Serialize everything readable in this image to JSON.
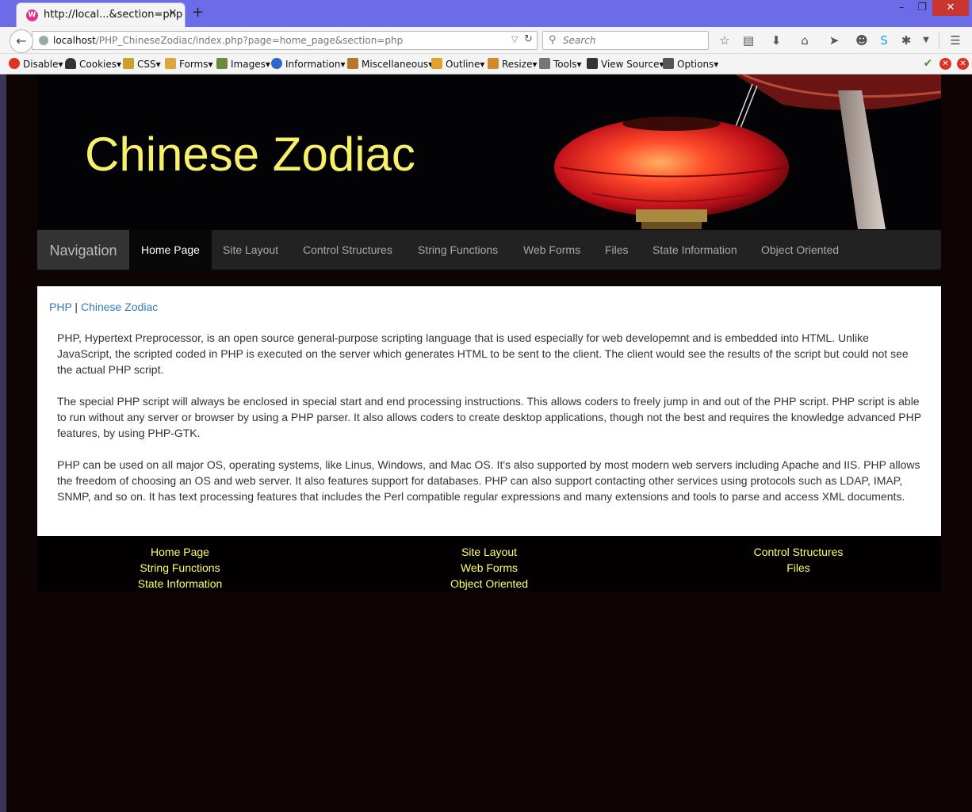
{
  "browser": {
    "tab_title": "http://local...&section=php",
    "tab_close": "✕",
    "new_tab": "+",
    "url_host": "localhost",
    "url_path": "/PHP_ChineseZodiac/index.php?page=home_page&section=php",
    "search_placeholder": "Search",
    "window_minimize": "–",
    "window_maximize": "❐",
    "window_close": "✕"
  },
  "devbar": {
    "items": [
      "Disable▾",
      "Cookies▾",
      "CSS▾",
      "Forms▾",
      "Images▾",
      "Information▾",
      "Miscellaneous▾",
      "Outline▾",
      "Resize▾",
      "Tools▾",
      "View Source▾",
      "Options▾"
    ]
  },
  "site": {
    "banner_title": "Chinese Zodiac",
    "nav_brand": "Navigation",
    "nav_links": [
      "Home Page",
      "Site Layout",
      "Control Structures",
      "String Functions",
      "Web Forms",
      "Files",
      "State Information",
      "Object Oriented"
    ],
    "active_nav": "Home Page",
    "breadcrumb": {
      "first": "PHP",
      "separator": " | ",
      "second": "Chinese Zodiac"
    },
    "paragraphs": [
      "PHP, Hypertext Preprocessor, is an open source general-purpose scripting language that is used especially for web developemnt and is embedded into HTML. Unlike JavaScript, the scripted coded in PHP is executed on the server which generates HTML to be sent to the client. The client would see the results of the script but could not see the actual PHP script.",
      "The special PHP script will always be enclosed in special start and end processing instructions. This allows coders to freely jump in and out of the PHP script. PHP script is able to run without any server or browser by using a PHP parser. It also allows coders to create desktop applications, though not the best and requires the knowledge advanced PHP features, by using PHP-GTK.",
      "PHP can be used on all major OS, operating systems, like Linus, Windows, and Mac OS. It's also supported by most modern web servers including Apache and IIS. PHP allows the freedom of choosing an OS and web server. It also features support for databases. PHP can also support contacting other services using protocols such as LDAP, IMAP, SNMP, and so on. It has text processing features that includes the Perl compatible regular expressions and many extensions and tools to parse and access XML documents."
    ],
    "footer_links": [
      "Home Page",
      "Site Layout",
      "Control Structures",
      "String Functions",
      "Web Forms",
      "Files",
      "State Information",
      "Object Oriented"
    ]
  },
  "colors": {
    "banner_title": "#f7f06b",
    "footer_link": "#ffff66",
    "breadcrumb_link": "#337ab7",
    "page_background": "#0e0404"
  }
}
